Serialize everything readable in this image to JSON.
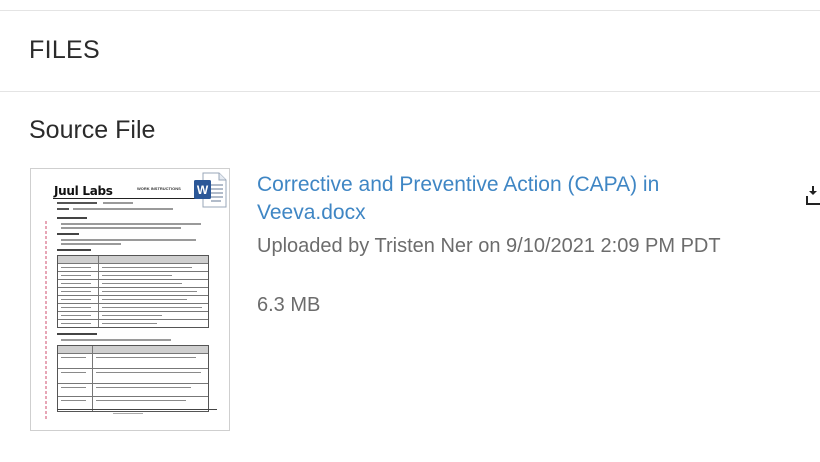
{
  "section": {
    "title": "FILES"
  },
  "source": {
    "title": "Source File",
    "file_name": "Corrective and Preventive Action (CAPA) in Veeva.docx",
    "uploaded_text": "Uploaded by Tristen Ner on 9/10/2021 2:09 PM PDT",
    "size": "6.3 MB",
    "file_type_icon": "word-document-icon",
    "thumbnail": {
      "logo": "Juul Labs",
      "header": "WORK INSTRUCTIONS"
    }
  },
  "colors": {
    "link": "#3f86c4",
    "meta_text": "#6c6c6c",
    "word_blue": "#2b5797"
  }
}
